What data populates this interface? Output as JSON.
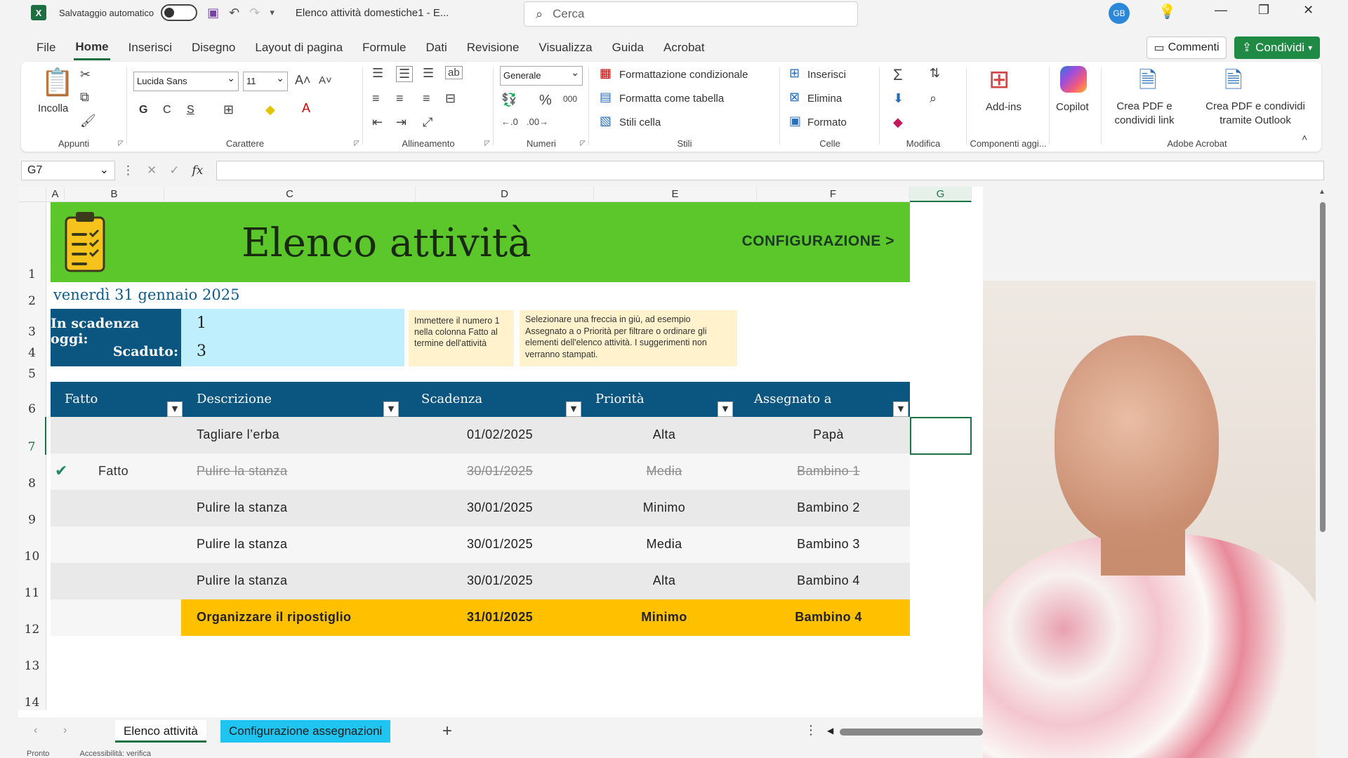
{
  "titlebar": {
    "autosave_label": "Salvataggio automatico",
    "doc_title": "Elenco attività domestiche1  -  E...",
    "search_placeholder": "Cerca",
    "avatar_initials": "GB"
  },
  "menu": {
    "tabs": [
      "File",
      "Home",
      "Inserisci",
      "Disegno",
      "Layout di pagina",
      "Formule",
      "Dati",
      "Revisione",
      "Visualizza",
      "Guida",
      "Acrobat"
    ],
    "active": "Home",
    "comments_label": "Commenti",
    "share_label": "Condividi"
  },
  "ribbon": {
    "clipboard": {
      "paste_label": "Incolla",
      "group": "Appunti"
    },
    "font": {
      "name": "Lucida Sans",
      "size": "11",
      "bold": "G",
      "italic": "C",
      "underline": "S",
      "group": "Carattere"
    },
    "alignment": {
      "group": "Allineamento"
    },
    "number": {
      "format": "Generale",
      "group": "Numeri"
    },
    "styles": {
      "conditional": "Formattazione condizionale",
      "as_table": "Formatta come tabella",
      "cell_styles": "Stili cella",
      "group": "Stili"
    },
    "cells": {
      "insert": "Inserisci",
      "delete": "Elimina",
      "format": "Formato",
      "group": "Celle"
    },
    "editing": {
      "group": "Modifica"
    },
    "addins": {
      "label": "Add-ins",
      "group": "Componenti aggi..."
    },
    "copilot": {
      "label": "Copilot"
    },
    "acrobat": {
      "pdf_link": "Crea PDF e condividi link",
      "pdf_outlook": "Crea PDF e condividi tramite Outlook",
      "group": "Adobe Acrobat"
    }
  },
  "formula_bar": {
    "cell_ref": "G7",
    "fx": "fx"
  },
  "grid": {
    "columns": [
      "A",
      "B",
      "C",
      "D",
      "E",
      "F",
      "G"
    ],
    "rows": [
      "1",
      "2",
      "3",
      "4",
      "5",
      "6",
      "7",
      "8",
      "9",
      "10",
      "11",
      "12",
      "13",
      "14"
    ]
  },
  "sheet": {
    "title": "Elenco attività",
    "config_link": "CONFIGURAZIONE >",
    "date": "venerdì 31 gennaio 2025",
    "due_today_label": "In scadenza oggi:",
    "due_today_value": "1",
    "overdue_label": "Scaduto:",
    "overdue_value": "3",
    "note1": "Immettere il numero 1 nella colonna Fatto al termine dell'attività",
    "note2": "Selezionare una freccia in giù, ad esempio Assegnato a o Priorità per filtrare o ordinare gli elementi dell'elenco attività. I suggerimenti non verranno stampati.",
    "headers": [
      "Fatto",
      "Descrizione",
      "Scadenza",
      "Priorità",
      "Assegnato a"
    ],
    "tasks": [
      {
        "done": "",
        "desc": "Tagliare l’erba",
        "due": "01/02/2025",
        "priority": "Alta",
        "assigned": "Papà"
      },
      {
        "done": "Fatto",
        "desc": "Pulire la stanza",
        "due": "30/01/2025",
        "priority": "Media",
        "assigned": "Bambino 1"
      },
      {
        "done": "",
        "desc": "Pulire la stanza",
        "due": "30/01/2025",
        "priority": "Minimo",
        "assigned": "Bambino 2"
      },
      {
        "done": "",
        "desc": "Pulire la stanza",
        "due": "30/01/2025",
        "priority": "Media",
        "assigned": "Bambino 3"
      },
      {
        "done": "",
        "desc": "Pulire la stanza",
        "due": "30/01/2025",
        "priority": "Alta",
        "assigned": "Bambino 4"
      },
      {
        "done": "",
        "desc": "Organizzare il ripostiglio",
        "due": "31/01/2025",
        "priority": "Minimo",
        "assigned": "Bambino 4"
      }
    ]
  },
  "tabs": {
    "active": "Elenco attività",
    "config": "Configurazione assegnazioni"
  },
  "status": {
    "ready": "Pronto",
    "accessibility": "Accessibilità: verifica"
  },
  "colors": {
    "banner": "#5cc72b",
    "header": "#0b5681",
    "summary_value": "#bfeffc",
    "highlight": "#ffc000",
    "note": "#fff2cc",
    "tab_config": "#1fc5f0"
  }
}
